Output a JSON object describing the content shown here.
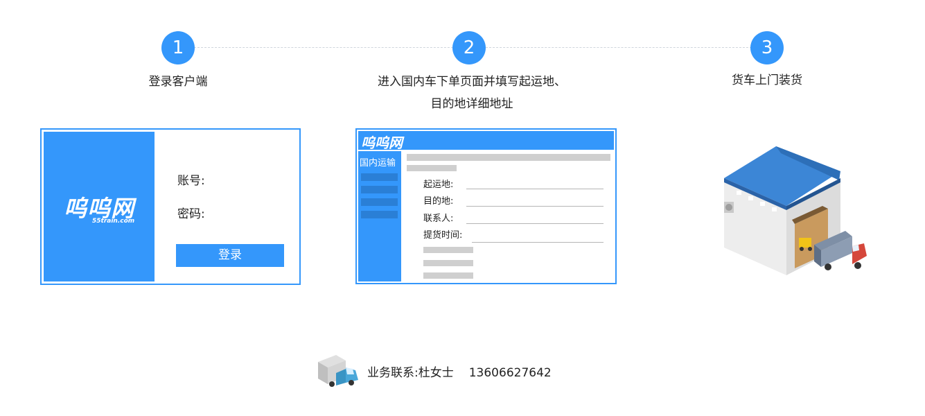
{
  "steps": [
    {
      "number": "1",
      "label": "登录客户端"
    },
    {
      "number": "2",
      "label_line1": "进入国内车下单页面并填写起运地、",
      "label_line2": "目的地详细地址"
    },
    {
      "number": "3",
      "label": "货车上门装货"
    }
  ],
  "login_card": {
    "brand_logo": "呜呜网",
    "brand_domain": "55train.com",
    "account_label": "账号:",
    "password_label": "密码:",
    "login_button": "登录"
  },
  "order_card": {
    "brand_logo": "呜呜网",
    "side_title": "国内运输",
    "fields": [
      "起运地:",
      "目的地:",
      "联系人:",
      "提货时间:"
    ]
  },
  "footer": {
    "contact_label": "业务联系:",
    "contact_name": "杜女士",
    "contact_phone": "13606627642"
  },
  "colors": {
    "accent": "#3497fb",
    "placeholder_grey": "#cfcfcf"
  }
}
